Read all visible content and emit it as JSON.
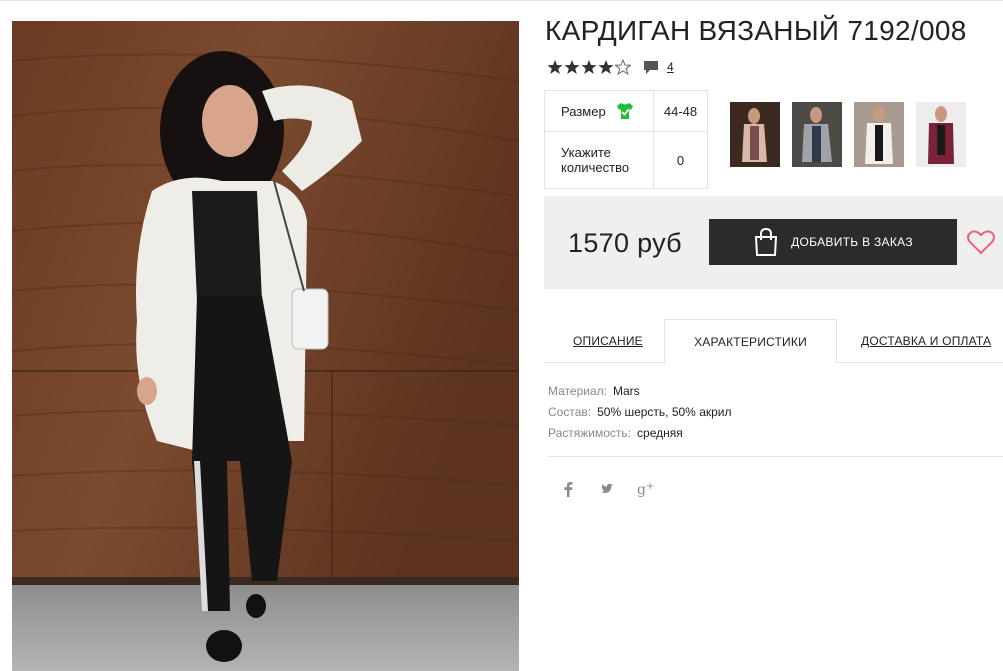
{
  "product": {
    "title": "КАРДИГАН ВЯЗАНЫЙ 7192/008",
    "rating": 4,
    "rating_max": 5,
    "review_count": "4"
  },
  "specs": {
    "size_label": "Размер",
    "size_value": "44-48",
    "qty_label": "Укажите количество",
    "qty_value": "0"
  },
  "price": {
    "amount": "1570 руб",
    "order_label": "ДОБАВИТЬ В ЗАКАЗ"
  },
  "tabs": [
    {
      "label": "ОПИСАНИЕ",
      "active": false
    },
    {
      "label": "ХАРАКТЕРИСТИКИ",
      "active": true
    },
    {
      "label": "ДОСТАВКА И ОПЛАТА",
      "active": false
    }
  ],
  "characteristics": [
    {
      "key": "Материал:",
      "value": "Mars"
    },
    {
      "key": "Состав:",
      "value": "50% шерсть, 50% акрил"
    },
    {
      "key": "Растяжимость:",
      "value": "средняя"
    }
  ],
  "icons": {
    "rating": "star-icon",
    "reviews": "comment-bubble-icon",
    "size_ok": "tshirt-check-icon",
    "order": "shopping-bag-icon",
    "wishlist": "heart-icon",
    "social": [
      "facebook-icon",
      "twitter-icon",
      "google-plus-icon"
    ]
  },
  "colors": {
    "accent_green": "#1fbf3c",
    "button_dark": "#2b2b2b",
    "heart_pink": "#e8647a",
    "panel_gray": "#efefef"
  }
}
